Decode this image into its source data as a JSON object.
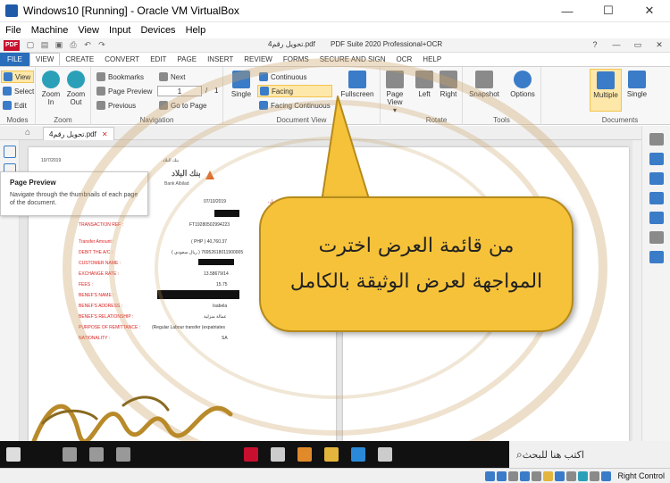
{
  "vbox": {
    "title": "Windows10 [Running] - Oracle VM VirtualBox",
    "menus": [
      "File",
      "Machine",
      "View",
      "Input",
      "Devices",
      "Help"
    ],
    "controls": {
      "minimize": "—",
      "maximize": "☐",
      "close": "✕"
    },
    "status_host_key": "Right Control"
  },
  "app": {
    "logo_text": "PDF",
    "doc_title": "تحويل رقم4.pdf",
    "product": "PDF Suite 2020  Professional+OCR",
    "win_controls": {
      "help": "?",
      "minimize": "—",
      "restore": "▭",
      "close": "✕"
    }
  },
  "ribbon": {
    "tabs": [
      "FILE",
      "VIEW",
      "CREATE",
      "CONVERT",
      "EDIT",
      "PAGE",
      "INSERT",
      "REVIEW",
      "FORMS",
      "SECURE AND SIGN",
      "OCR",
      "HELP"
    ],
    "active_tab": "VIEW",
    "modes": {
      "label": "Modes",
      "view": "View",
      "select": "Select",
      "edit": "Edit"
    },
    "zoom": {
      "label": "Zoom",
      "zoom_in": "Zoom In",
      "zoom_out": "Zoom Out"
    },
    "navigation": {
      "label": "Navigation",
      "bookmarks": "Bookmarks",
      "page_preview": "Page Preview",
      "previous": "Previous",
      "next": "Next",
      "go_to_page": "Go to Page",
      "current_page": "1",
      "page_sep": "/",
      "total_pages": "1"
    },
    "document_view": {
      "label": "Document View",
      "single": "Single",
      "continuous": "Continuous",
      "facing": "Facing",
      "facing_continuous": "Facing Continuous",
      "fullscreen": "Fullscreen",
      "page_view": "Page View"
    },
    "rotate": {
      "label": "Rotate",
      "left": "Left",
      "right": "Right"
    },
    "tools": {
      "label": "Tools",
      "snapshot": "Snapshot",
      "options": "Options"
    },
    "documents": {
      "label": "Documents",
      "multiple": "Multiple",
      "single": "Single"
    }
  },
  "doc_tab": {
    "name": "تحويل رقم4.pdf",
    "close": "✕"
  },
  "tooltip": {
    "title": "Page Preview",
    "description": "Navigate through the thumbnails of each page of the document."
  },
  "document": {
    "top_date": "10/7/2019",
    "bank_name_ar": "بنك البلاد",
    "bank_name_en": "Bank Albilad",
    "date": "07/10/2019",
    "greeting_ar": "عزيزنا العميل،",
    "transaction_ref_label": "TRANSACTION REF :",
    "transaction_ref": "FT19280502994223",
    "rows": [
      {
        "label": "Transfer Amount :",
        "value": "( PHP )   40,760.37"
      },
      {
        "label": "DEBIT THE A/C :",
        "value": "( ريال سعودي )   76952618011900005"
      },
      {
        "label": "CUSTOMER NAME :",
        "value": ""
      },
      {
        "label": "EXCHANGE RATE :",
        "value": "13.58679/14"
      },
      {
        "label": "FEES :",
        "value": "15.75"
      },
      {
        "label": "BENEF'S NAME :",
        "value": ""
      },
      {
        "label": "BENEF'S ADDRESS :",
        "value": "Isabela"
      },
      {
        "label": "BENEF'S RELATIONSHIP :",
        "value": "عمالة منزلية"
      },
      {
        "label": "PURPOSE OF REMITTANCE :",
        "value": "(Regular Labour transfer (expatriates"
      },
      {
        "label": "NATIONALITY :",
        "value": "SA"
      }
    ]
  },
  "callout": {
    "line1": "من قائمة العرض اخترت",
    "line2": "المواجهة لعرض الوثيقة بالكامل"
  },
  "taskbar": {
    "search_placeholder": "اكتب هنا للبحث"
  },
  "colors": {
    "accent": "#2a6ebb",
    "selected": "#fde7a9",
    "callout": "#f6c239",
    "label_red": "#d22222",
    "watermark": "#c9a060"
  },
  "icons": [
    "windows-start-icon",
    "search-icon",
    "pdf-icon",
    "mail-icon",
    "store-icon",
    "folder-icon",
    "edge-icon",
    "virtualbox-icon"
  ]
}
